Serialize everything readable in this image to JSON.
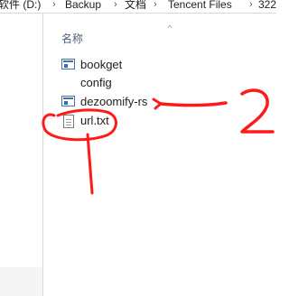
{
  "address_bar": {
    "crumbs": [
      "软件 (D:)",
      "Backup",
      "文档",
      "Tencent Files",
      "322"
    ]
  },
  "file_list": {
    "column_header": "名称",
    "sort_indicator": "^",
    "files": [
      {
        "name": "bookget",
        "icon": "application-icon"
      },
      {
        "name": "config",
        "icon": "none"
      },
      {
        "name": "dezoomify-rs",
        "icon": "application-icon"
      },
      {
        "name": "url.txt",
        "icon": "text-file-icon"
      }
    ]
  },
  "annotations": {
    "stroke_color": "#ff1a1a"
  }
}
